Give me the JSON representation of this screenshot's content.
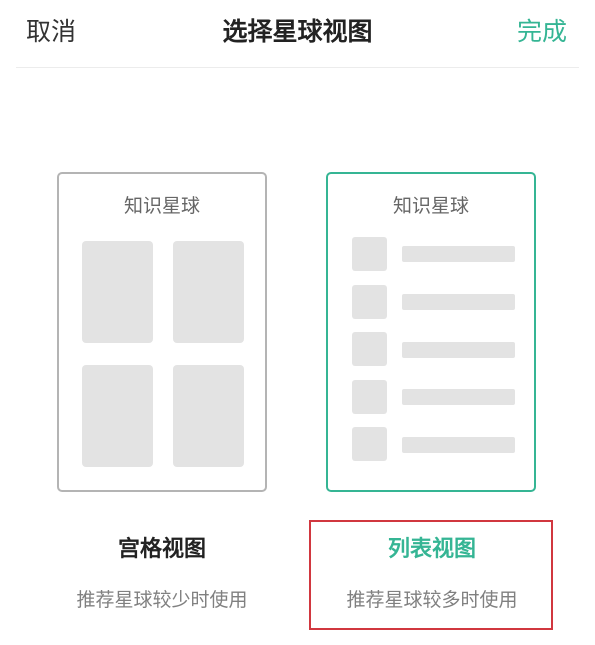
{
  "header": {
    "cancel_label": "取消",
    "title": "选择星球视图",
    "done_label": "完成"
  },
  "colors": {
    "accent": "#35b594",
    "highlight": "#d1373f"
  },
  "options": [
    {
      "card_title": "知识星球",
      "label": "宫格视图",
      "description": "推荐星球较少时使用",
      "selected": false
    },
    {
      "card_title": "知识星球",
      "label": "列表视图",
      "description": "推荐星球较多时使用",
      "selected": true
    }
  ]
}
